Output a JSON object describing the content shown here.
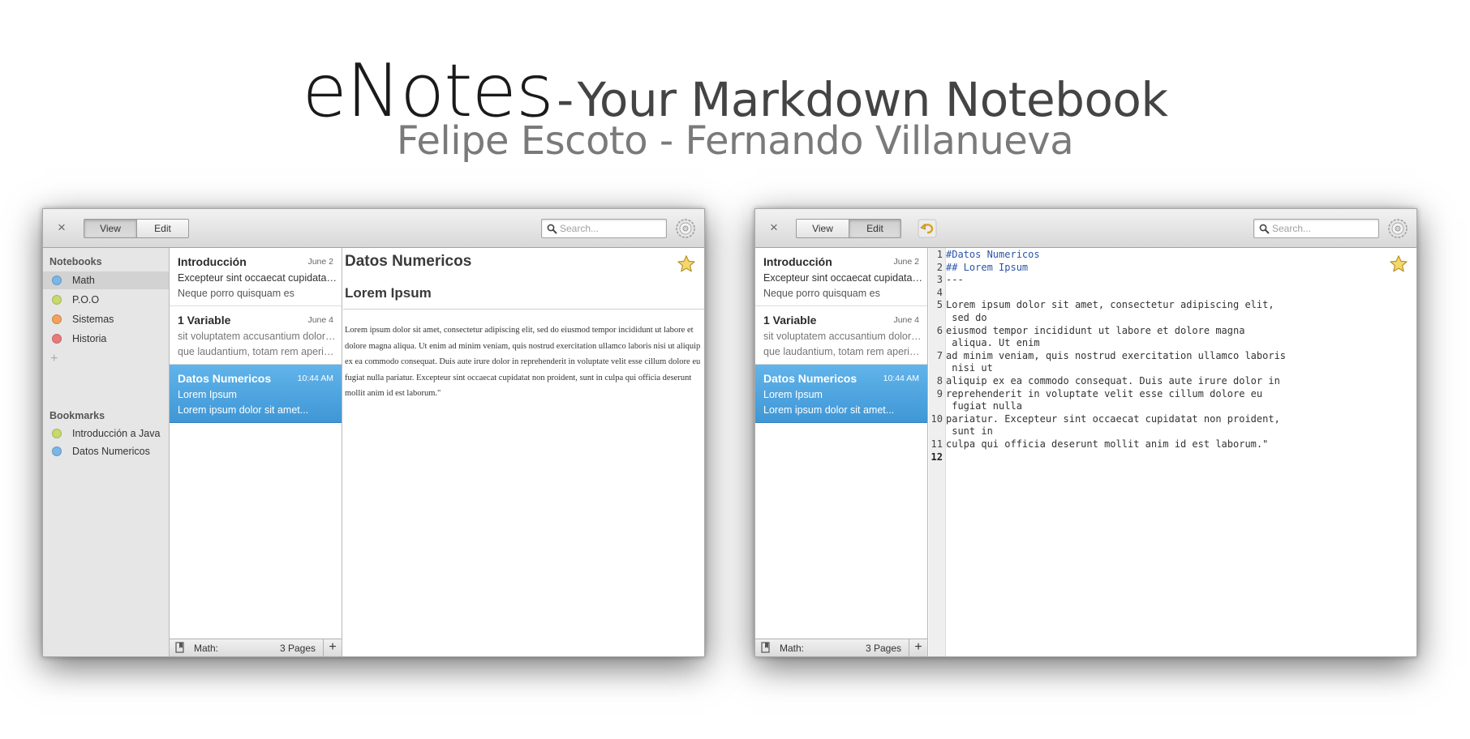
{
  "hero": {
    "app_name": "eNotes",
    "dash": "-",
    "tagline": "Your Markdown Notebook",
    "authors": "Felipe Escoto - Fernando Villanueva"
  },
  "toolbar": {
    "close_glyph": "×",
    "view_label": "View",
    "edit_label": "Edit",
    "search_placeholder": "Search..."
  },
  "sidebar": {
    "notebooks_header": "Notebooks",
    "notebooks": [
      {
        "label": "Math",
        "color": "#7ab6e6"
      },
      {
        "label": "P.O.O",
        "color": "#c6d96a"
      },
      {
        "label": "Sistemas",
        "color": "#f2a15c"
      },
      {
        "label": "Historia",
        "color": "#e97a7a"
      }
    ],
    "add_glyph": "+",
    "bookmarks_header": "Bookmarks",
    "bookmarks": [
      {
        "label": "Introducción a Java",
        "color": "#c6d96a"
      },
      {
        "label": "Datos Numericos",
        "color": "#7ab6e6"
      }
    ]
  },
  "notes_left": [
    {
      "title": "Introducción",
      "date": "June 2",
      "line1": "Excepteur sint occaecat cupidatat non proident",
      "line2": "Neque porro quisquam es"
    },
    {
      "title": "1 Variable",
      "date": "June 4",
      "line1": "sit voluptatem accusantium doloremque",
      "line2": "que laudantium, totam rem aperiam"
    },
    {
      "title": "Datos Numericos",
      "date": "10:44 AM",
      "line1": "Lorem Ipsum",
      "line2": "Lorem ipsum dolor sit amet..."
    }
  ],
  "notes_right": [
    {
      "title": "Introducción",
      "date": "June 2",
      "line1": "Excepteur sint occaecat cupidatat non proident",
      "line2": "Neque porro quisquam es"
    },
    {
      "title": "1 Variable",
      "date": "June 4",
      "line1": "sit voluptatem accusantium doloremque",
      "line2": "que laudantium, totam rem aperiam"
    },
    {
      "title": "Datos Numericos",
      "date": "10:44 AM",
      "line1": "Lorem Ipsum",
      "line2": "Lorem ipsum dolor sit amet..."
    }
  ],
  "footer": {
    "notebook": "Math:",
    "pages": "3 Pages",
    "add_glyph": "+"
  },
  "viewer": {
    "h1": "Datos Numericos",
    "h2": "Lorem Ipsum",
    "body": "Lorem ipsum dolor sit amet, consectetur adipiscing elit, sed do eiusmod tempor incididunt ut labore et dolore magna aliqua. Ut enim ad minim veniam, quis nostrud exercitation ullamco laboris nisi ut aliquip ex ea commodo consequat. Duis aute irure dolor in reprehenderit in voluptate velit esse cillum dolore eu fugiat nulla pariatur. Excepteur sint occaecat cupidatat non proident, sunt in culpa qui officia deserunt mollit anim id est laborum.\""
  },
  "editor": {
    "lines": [
      {
        "n": "1",
        "text": "#Datos Numericos",
        "md": true
      },
      {
        "n": "2",
        "text": "## Lorem Ipsum",
        "md": true
      },
      {
        "n": "3",
        "text": "---",
        "md": false
      },
      {
        "n": "4",
        "text": "",
        "md": false
      },
      {
        "n": "5",
        "text": "Lorem ipsum dolor sit amet, consectetur adipiscing elit,",
        "md": false
      },
      {
        "n": "",
        "text": " sed do",
        "md": false
      },
      {
        "n": "6",
        "text": "eiusmod tempor incididunt ut labore et dolore magna",
        "md": false
      },
      {
        "n": "",
        "text": " aliqua. Ut enim",
        "md": false
      },
      {
        "n": "7",
        "text": "ad minim veniam, quis nostrud exercitation ullamco laboris",
        "md": false
      },
      {
        "n": "",
        "text": " nisi ut",
        "md": false
      },
      {
        "n": "8",
        "text": "aliquip ex ea commodo consequat. Duis aute irure dolor in",
        "md": false
      },
      {
        "n": "9",
        "text": "reprehenderit in voluptate velit esse cillum dolore eu",
        "md": false
      },
      {
        "n": "",
        "text": " fugiat nulla",
        "md": false
      },
      {
        "n": "10",
        "text": "pariatur. Excepteur sint occaecat cupidatat non proident,",
        "md": false
      },
      {
        "n": "",
        "text": " sunt in",
        "md": false
      },
      {
        "n": "11",
        "text": "culpa qui officia deserunt mollit anim id est laborum.\"",
        "md": false
      },
      {
        "n": "12",
        "text": "",
        "md": false,
        "current": true
      }
    ]
  },
  "colors": {
    "accent": "#4aa3e0",
    "star": "#f5d76e"
  },
  "icons": {
    "close": "close-icon",
    "search": "search-icon",
    "settings": "gear-icon",
    "undo": "undo-icon",
    "star": "star-icon",
    "bookmark": "bookmark-icon",
    "add": "plus-icon"
  }
}
